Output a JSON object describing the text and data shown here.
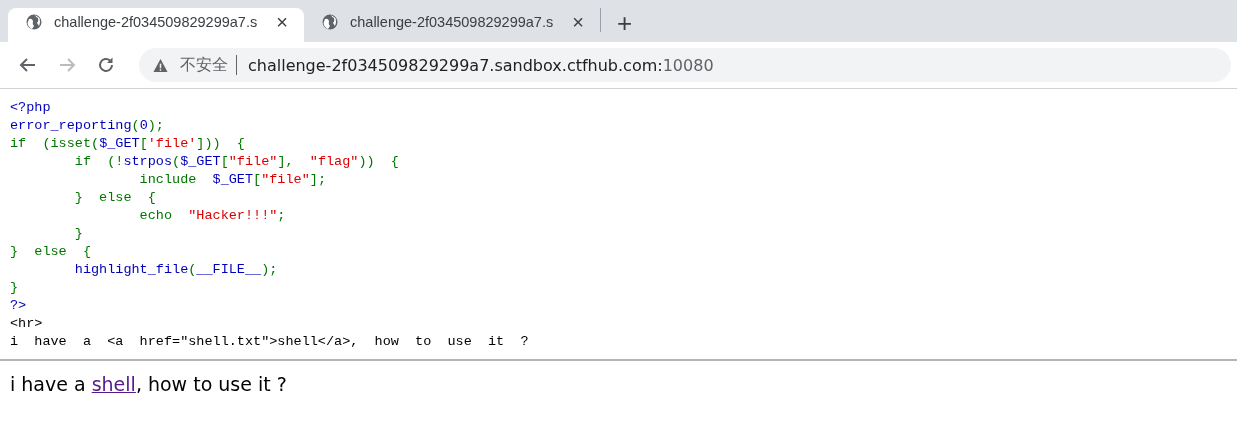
{
  "tabs": [
    {
      "title": "challenge-2f034509829299a7.s",
      "selected": true,
      "close": "×"
    },
    {
      "title": "challenge-2f034509829299a7.s",
      "selected": false,
      "close": "×"
    }
  ],
  "new_tab": "+",
  "address_bar": {
    "security": "不安全",
    "host": "challenge-2f034509829299a7.sandbox.ctfhub.com:",
    "port": "10080"
  },
  "code_lines": [
    [
      {
        "kind": "default",
        "text": "<?php"
      }
    ],
    [
      {
        "kind": "default",
        "text": "error_reporting"
      },
      {
        "kind": "keyword",
        "text": "("
      },
      {
        "kind": "default",
        "text": "0"
      },
      {
        "kind": "keyword",
        "text": ");"
      }
    ],
    [
      {
        "kind": "keyword",
        "text": "if  (isset("
      },
      {
        "kind": "default",
        "text": "$_GET"
      },
      {
        "kind": "keyword",
        "text": "["
      },
      {
        "kind": "string",
        "text": "'file'"
      },
      {
        "kind": "keyword",
        "text": "]))  {"
      }
    ],
    [
      {
        "kind": "keyword",
        "text": "        if  (!"
      },
      {
        "kind": "default",
        "text": "strpos"
      },
      {
        "kind": "keyword",
        "text": "("
      },
      {
        "kind": "default",
        "text": "$_GET"
      },
      {
        "kind": "keyword",
        "text": "["
      },
      {
        "kind": "string",
        "text": "\"file\""
      },
      {
        "kind": "keyword",
        "text": "],  "
      },
      {
        "kind": "string",
        "text": "\"flag\""
      },
      {
        "kind": "keyword",
        "text": "))  {"
      }
    ],
    [
      {
        "kind": "keyword",
        "text": "                include  "
      },
      {
        "kind": "default",
        "text": "$_GET"
      },
      {
        "kind": "keyword",
        "text": "["
      },
      {
        "kind": "string",
        "text": "\"file\""
      },
      {
        "kind": "keyword",
        "text": "];"
      }
    ],
    [
      {
        "kind": "keyword",
        "text": "        }  else  {"
      }
    ],
    [
      {
        "kind": "keyword",
        "text": "                echo  "
      },
      {
        "kind": "string",
        "text": "\"Hacker!!!\""
      },
      {
        "kind": "keyword",
        "text": ";"
      }
    ],
    [
      {
        "kind": "keyword",
        "text": "        }"
      }
    ],
    [
      {
        "kind": "keyword",
        "text": "}  else  {"
      }
    ],
    [
      {
        "kind": "default",
        "text": "        highlight_file"
      },
      {
        "kind": "keyword",
        "text": "("
      },
      {
        "kind": "default",
        "text": "__FILE__"
      },
      {
        "kind": "keyword",
        "text": ");"
      }
    ],
    [
      {
        "kind": "keyword",
        "text": "}"
      }
    ],
    [
      {
        "kind": "default",
        "text": "?>"
      }
    ],
    [
      {
        "kind": "html",
        "text": "<hr>"
      }
    ],
    [
      {
        "kind": "html",
        "text": "i  have  a  <a  href=\"shell.txt\">shell</a>,  how  to  use  it  ?"
      }
    ]
  ],
  "message": {
    "before": "i have a ",
    "link": "shell",
    "after": ", how to use it ?"
  }
}
